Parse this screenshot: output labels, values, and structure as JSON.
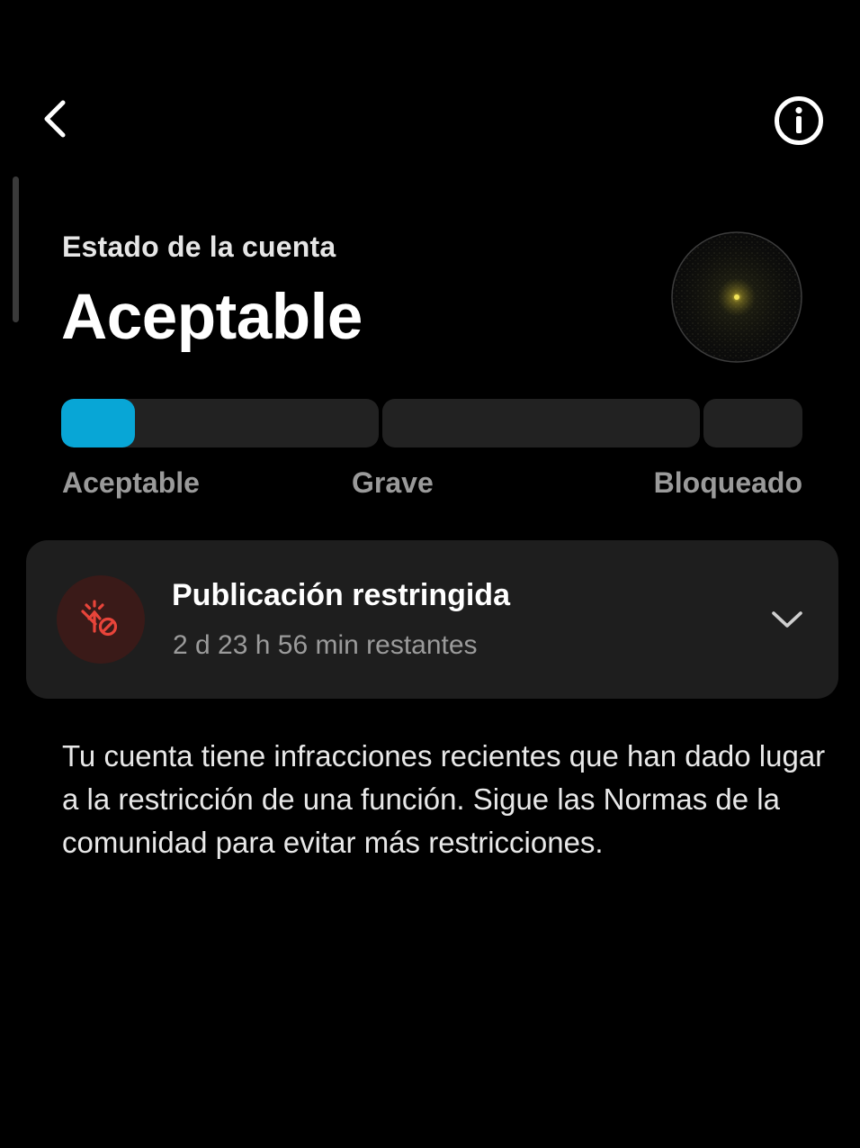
{
  "header": {
    "back_icon": "chevron-left-icon",
    "info_icon": "info-circle-icon"
  },
  "status": {
    "eyebrow": "Estado de la cuenta",
    "title": "Aceptable",
    "level_fraction": 0.1
  },
  "scale": {
    "labels": [
      "Aceptable",
      "Grave",
      "Bloqueado"
    ]
  },
  "restriction": {
    "icon": "restricted-post-icon",
    "title": "Publicación restringida",
    "time_remaining": "2 d 23 h 56 min restantes",
    "expand_icon": "chevron-down-icon"
  },
  "description": "Tu cuenta tiene infracciones recientes que han dado lugar a la restricción de una función. Sigue las Normas de la comunidad para evitar más restricciones.",
  "colors": {
    "background": "#000000",
    "accent": "#08a6d6",
    "card": "#1e1e1e",
    "danger": "#e8443a",
    "muted_text": "#9a9a9a"
  }
}
